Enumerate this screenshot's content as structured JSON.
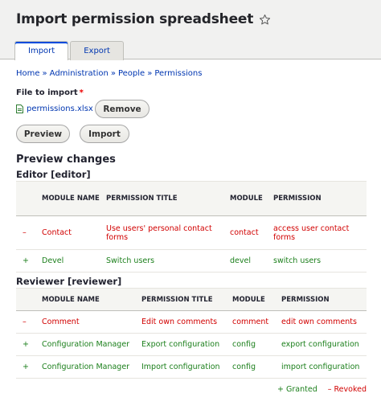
{
  "header": {
    "title": "Import permission spreadsheet",
    "tabs": [
      {
        "label": "Import",
        "active": true
      },
      {
        "label": "Export",
        "active": false
      }
    ]
  },
  "breadcrumb": {
    "items": [
      "Home",
      "Administration",
      "People",
      "Permissions"
    ],
    "separator": "»"
  },
  "form": {
    "file_label": "File to import",
    "required_mark": "*",
    "file_name": "permissions.xlsx",
    "remove_label": "Remove",
    "preview_label": "Preview",
    "import_label": "Import"
  },
  "preview": {
    "title": "Preview changes",
    "roles": [
      {
        "name": "Editor [editor]",
        "headers": [
          "",
          "MODULE NAME",
          "PERMISSION TITLE",
          "MODULE",
          "PERMISSION"
        ],
        "rows": [
          {
            "sign": "–",
            "status": "revoked",
            "module_name": "Contact",
            "permission_title": "Use users' personal contact forms",
            "module": "contact",
            "permission": "access user contact forms"
          },
          {
            "sign": "+",
            "status": "granted",
            "module_name": "Devel",
            "permission_title": "Switch users",
            "module": "devel",
            "permission": "switch users"
          }
        ]
      },
      {
        "name": "Reviewer [reviewer]",
        "headers": [
          "",
          "MODULE NAME",
          "PERMISSION TITLE",
          "MODULE",
          "PERMISSION"
        ],
        "rows": [
          {
            "sign": "–",
            "status": "revoked",
            "module_name": "Comment",
            "permission_title": "Edit own comments",
            "module": "comment",
            "permission": "edit own comments"
          },
          {
            "sign": "+",
            "status": "granted",
            "module_name": "Configuration Manager",
            "permission_title": "Export configuration",
            "module": "config",
            "permission": "export configuration"
          },
          {
            "sign": "+",
            "status": "granted",
            "module_name": "Configuration Manager",
            "permission_title": "Import configuration",
            "module": "config",
            "permission": "import configuration"
          }
        ]
      }
    ]
  },
  "legend": {
    "granted": "+ Granted",
    "revoked": "– Revoked"
  },
  "colors": {
    "link": "#0036b1",
    "granted": "#1b7f1b",
    "revoked": "#d10000",
    "active_tab_accent": "#004adc"
  },
  "icons": {
    "title_star": "star-outline-icon",
    "file": "spreadsheet-file-icon"
  }
}
